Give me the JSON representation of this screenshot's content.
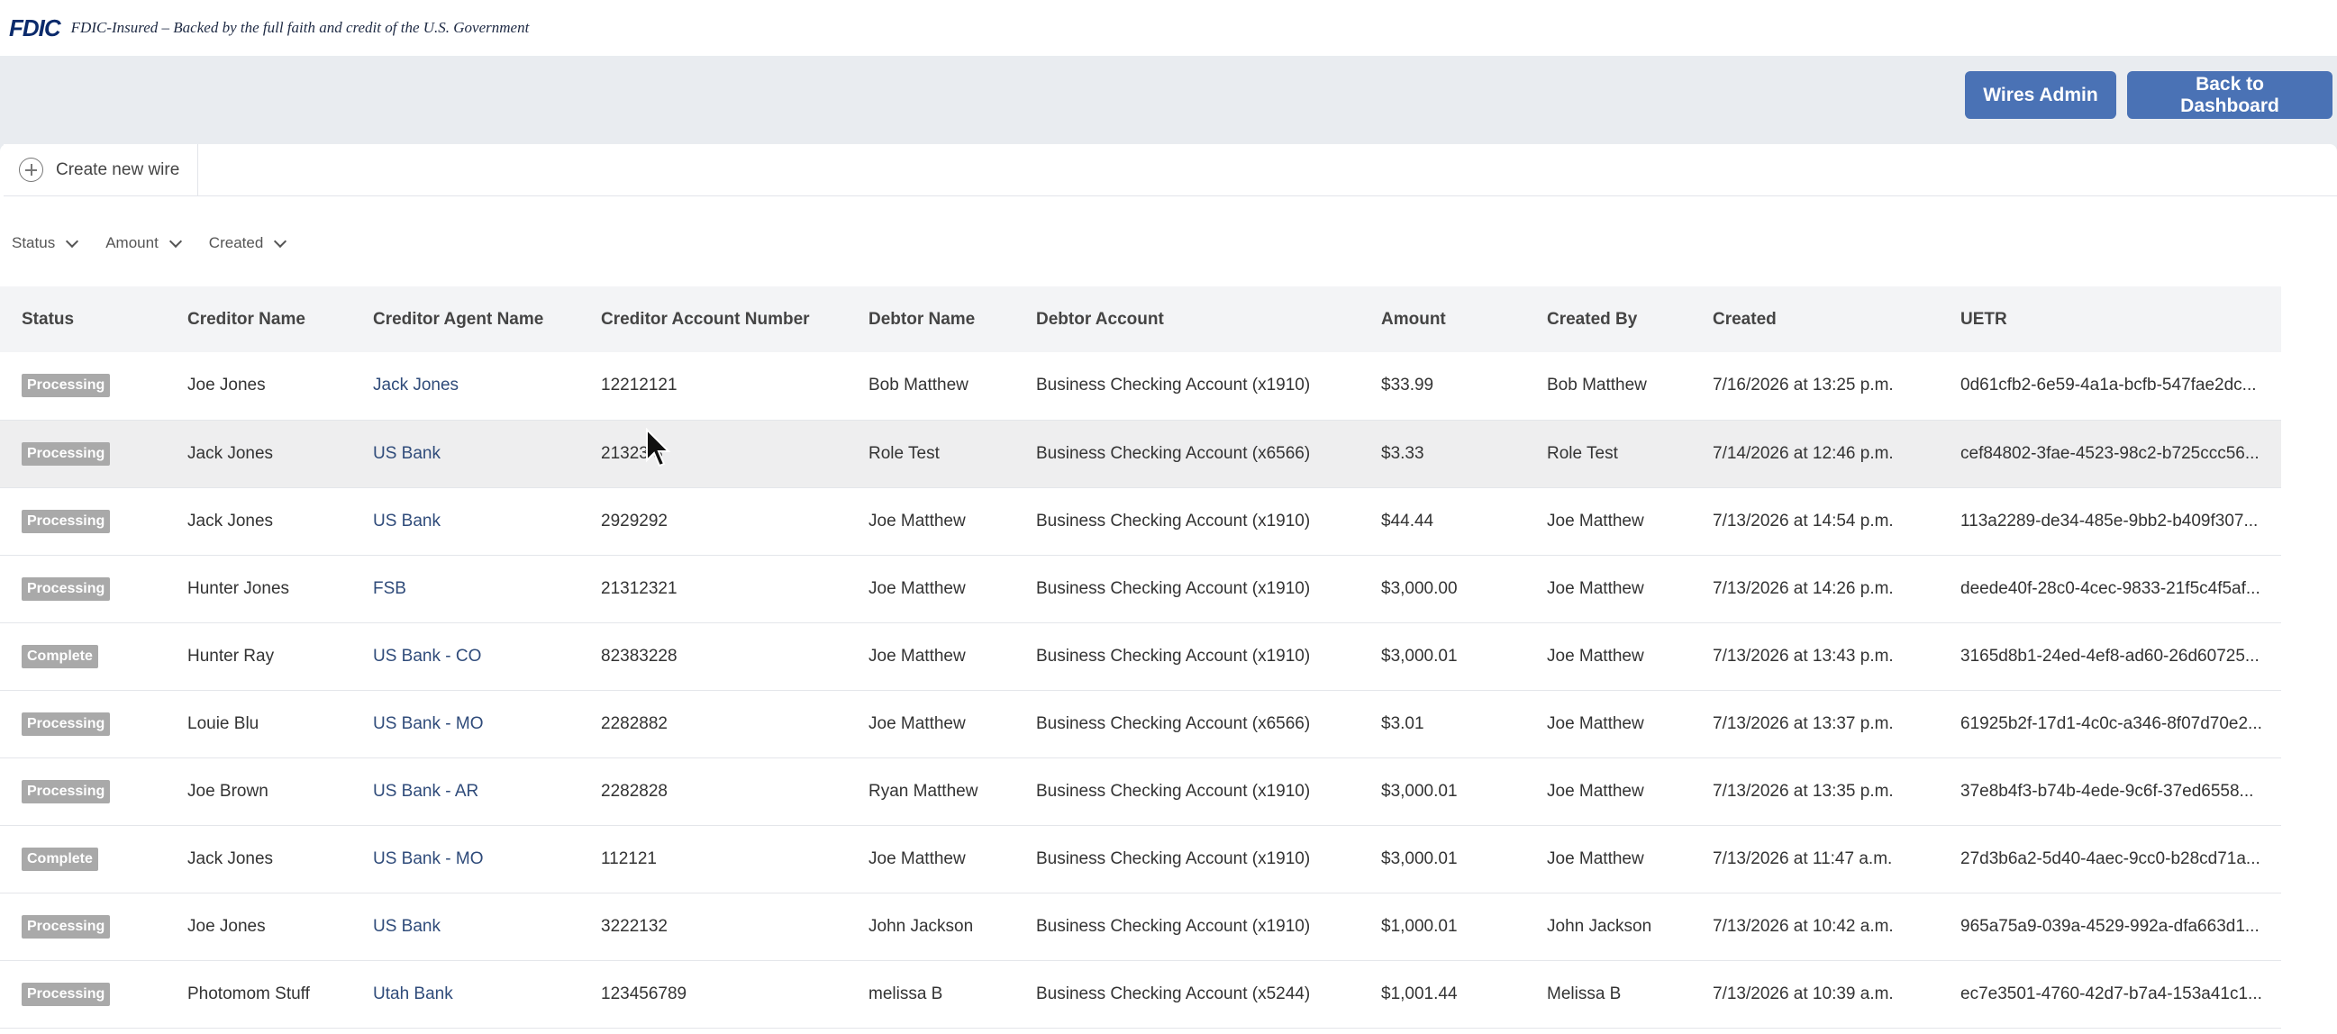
{
  "banner": {
    "logo": "FDIC",
    "text": "FDIC-Insured – Backed by the full faith and credit of the U.S. Government"
  },
  "actions": {
    "wires_admin": "Wires Admin",
    "back_to_dashboard": "Back to Dashboard"
  },
  "tabs": {
    "create_new_wire": "Create new wire"
  },
  "filters": {
    "status": "Status",
    "amount": "Amount",
    "created": "Created"
  },
  "table": {
    "headers": [
      "Status",
      "Creditor Name",
      "Creditor Agent Name",
      "Creditor Account Number",
      "Debtor Name",
      "Debtor Account",
      "Amount",
      "Created By",
      "Created",
      "UETR"
    ],
    "rows": [
      {
        "status": "Processing",
        "creditor": "Joe Jones",
        "agent": "Jack Jones",
        "account": "12212121",
        "debtor": "Bob Matthew",
        "debtor_account": "Business Checking Account (x1910)",
        "amount": "$33.99",
        "created_by": "Bob Matthew",
        "created": "7/16/2026 at 13:25 p.m.",
        "uetr": "0d61cfb2-6e59-4a1a-bcfb-547fae2dc..."
      },
      {
        "status": "Processing",
        "creditor": "Jack Jones",
        "agent": "US Bank",
        "account": "21323 3",
        "debtor": "Role Test",
        "debtor_account": "Business Checking Account (x6566)",
        "amount": "$3.33",
        "created_by": "Role Test",
        "created": "7/14/2026 at 12:46 p.m.",
        "uetr": "cef84802-3fae-4523-98c2-b725ccc56..."
      },
      {
        "status": "Processing",
        "creditor": "Jack Jones",
        "agent": "US Bank",
        "account": "2929292",
        "debtor": "Joe Matthew",
        "debtor_account": "Business Checking Account (x1910)",
        "amount": "$44.44",
        "created_by": "Joe Matthew",
        "created": "7/13/2026 at 14:54 p.m.",
        "uetr": "113a2289-de34-485e-9bb2-b409f307..."
      },
      {
        "status": "Processing",
        "creditor": "Hunter Jones",
        "agent": "FSB",
        "account": "21312321",
        "debtor": "Joe Matthew",
        "debtor_account": "Business Checking Account (x1910)",
        "amount": "$3,000.00",
        "created_by": "Joe Matthew",
        "created": "7/13/2026 at 14:26 p.m.",
        "uetr": "deede40f-28c0-4cec-9833-21f5c4f5af..."
      },
      {
        "status": "Complete",
        "creditor": "Hunter Ray",
        "agent": "US Bank - CO",
        "account": "82383228",
        "debtor": "Joe Matthew",
        "debtor_account": "Business Checking Account (x1910)",
        "amount": "$3,000.01",
        "created_by": "Joe Matthew",
        "created": "7/13/2026 at 13:43 p.m.",
        "uetr": "3165d8b1-24ed-4ef8-ad60-26d60725..."
      },
      {
        "status": "Processing",
        "creditor": "Louie Blu",
        "agent": "US Bank - MO",
        "account": "2282882",
        "debtor": "Joe Matthew",
        "debtor_account": "Business Checking Account (x6566)",
        "amount": "$3.01",
        "created_by": "Joe Matthew",
        "created": "7/13/2026 at 13:37 p.m.",
        "uetr": "61925b2f-17d1-4c0c-a346-8f07d70e2..."
      },
      {
        "status": "Processing",
        "creditor": "Joe Brown",
        "agent": "US Bank - AR",
        "account": "2282828",
        "debtor": "Ryan Matthew",
        "debtor_account": "Business Checking Account (x1910)",
        "amount": "$3,000.01",
        "created_by": "Joe Matthew",
        "created": "7/13/2026 at 13:35 p.m.",
        "uetr": "37e8b4f3-b74b-4ede-9c6f-37ed6558..."
      },
      {
        "status": "Complete",
        "creditor": "Jack Jones",
        "agent": "US Bank - MO",
        "account": "112121",
        "debtor": "Joe Matthew",
        "debtor_account": "Business Checking Account (x1910)",
        "amount": "$3,000.01",
        "created_by": "Joe Matthew",
        "created": "7/13/2026 at 11:47 a.m.",
        "uetr": "27d3b6a2-5d40-4aec-9cc0-b28cd71a..."
      },
      {
        "status": "Processing",
        "creditor": "Joe Jones",
        "agent": "US Bank",
        "account": "3222132",
        "debtor": "John Jackson",
        "debtor_account": "Business Checking Account (x1910)",
        "amount": "$1,000.01",
        "created_by": "John Jackson",
        "created": "7/13/2026 at 10:42 a.m.",
        "uetr": "965a75a9-039a-4529-992a-dfa663d1..."
      },
      {
        "status": "Processing",
        "creditor": "Photomom Stuff",
        "agent": "Utah Bank",
        "account": "123456789",
        "debtor": "melissa B",
        "debtor_account": "Business Checking Account (x5244)",
        "amount": "$1,001.44",
        "created_by": "Melissa B",
        "created": "7/13/2026 at 10:39 a.m.",
        "uetr": "ec7e3501-4760-42d7-b7a4-153a41c1..."
      }
    ]
  }
}
